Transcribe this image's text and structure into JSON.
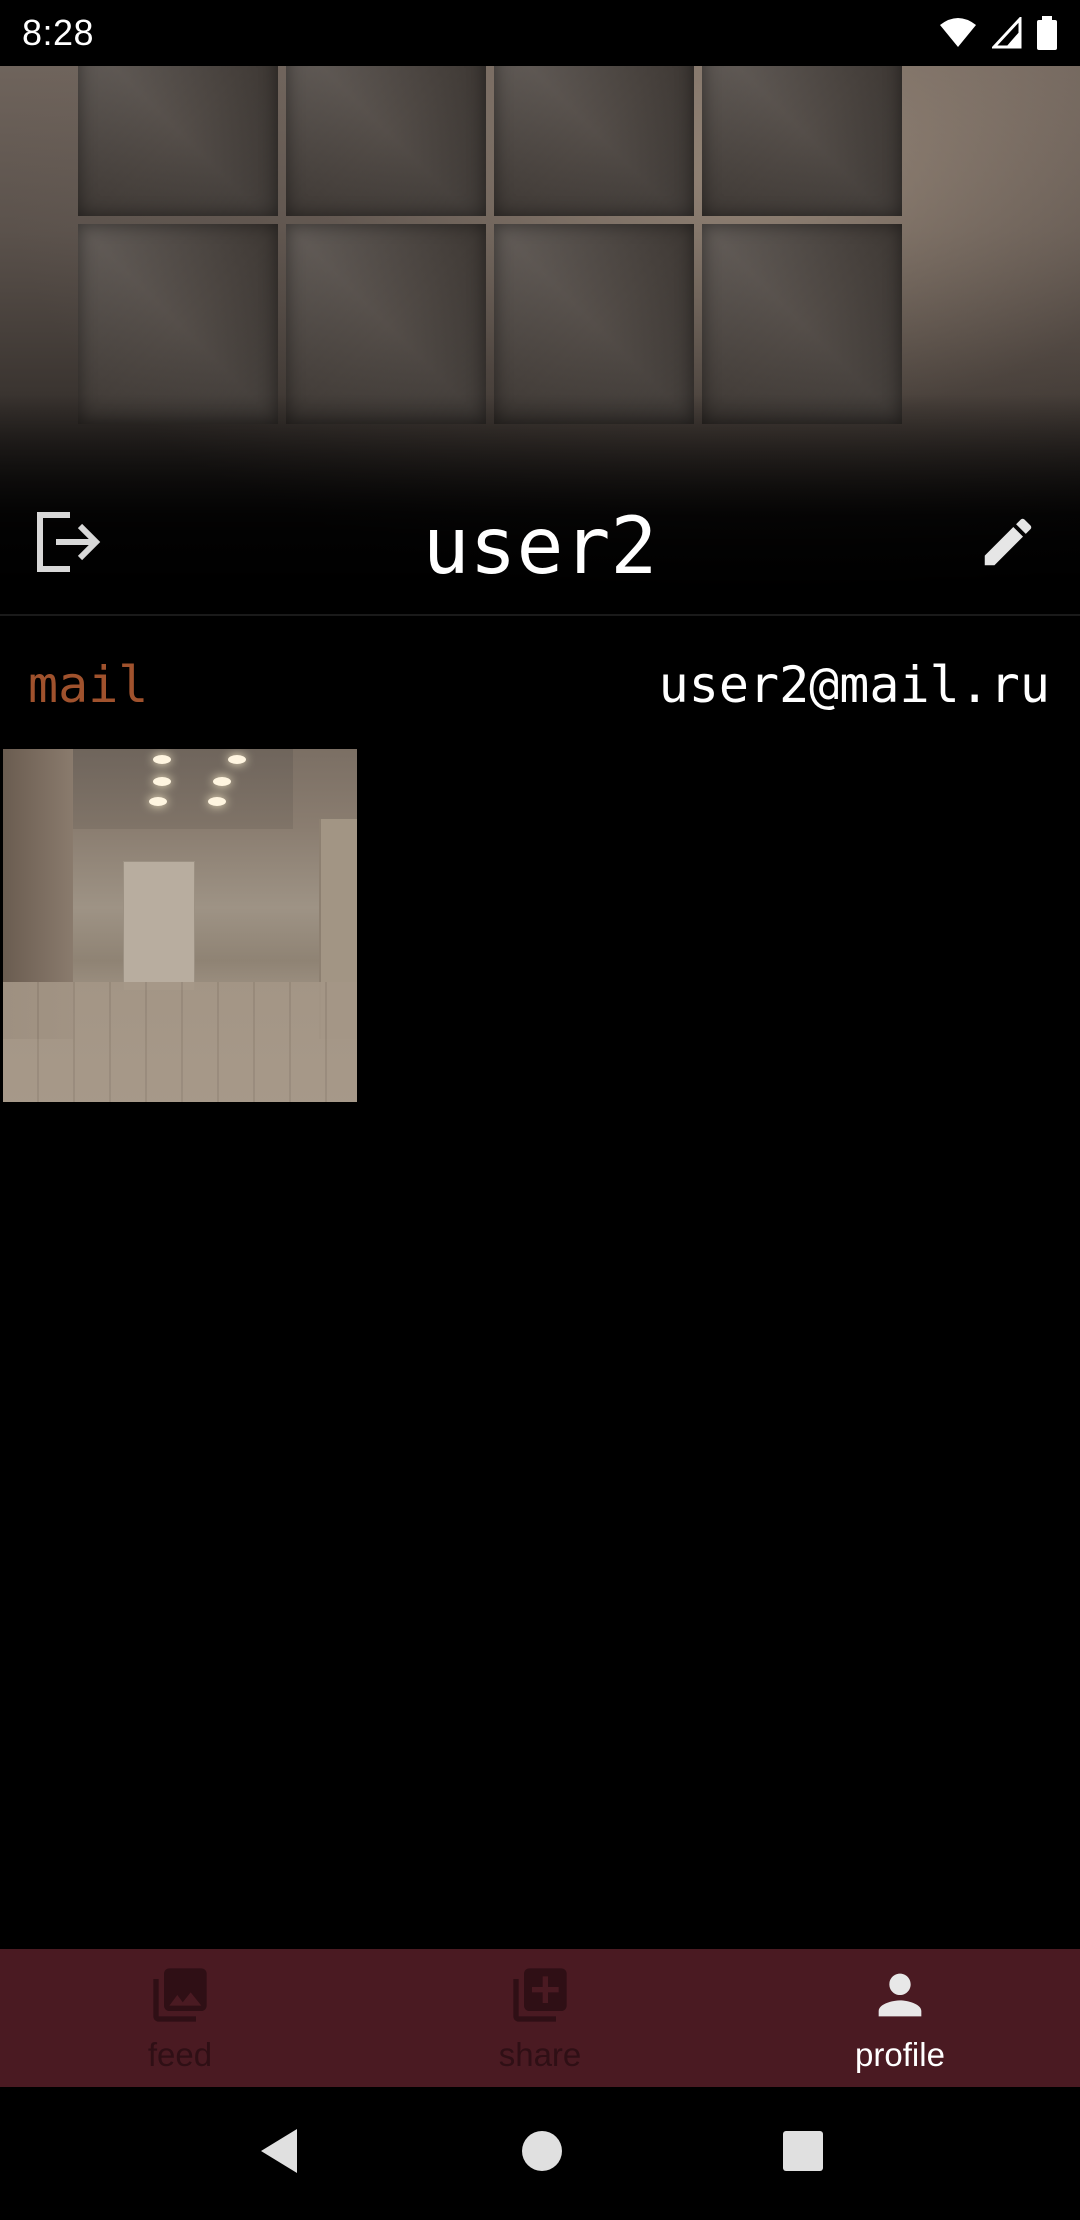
{
  "status_bar": {
    "time": "8:28",
    "icons": [
      "wifi-icon",
      "cellular-signal-icon",
      "battery-icon"
    ]
  },
  "profile": {
    "username": "user2",
    "logout_icon": "logout-icon",
    "edit_icon": "edit-pencil-icon",
    "mail_label": "mail",
    "mail_value": "user2@mail.ru"
  },
  "posts": [
    {
      "name": "post-thumbnail",
      "description_icon": "interior-photo"
    }
  ],
  "bottom_nav": {
    "items": [
      {
        "label": "feed",
        "icon": "photo-library-icon",
        "active": false
      },
      {
        "label": "share",
        "icon": "add-to-photos-icon",
        "active": false
      },
      {
        "label": "profile",
        "icon": "person-icon",
        "active": true
      }
    ]
  },
  "system_nav": {
    "icons": [
      "back-icon",
      "home-icon",
      "recents-icon"
    ]
  },
  "colors": {
    "background": "#000000",
    "mail_label": "#a0522d",
    "nav_background": "#4a1a22",
    "nav_inactive": "#2f0f15",
    "nav_active": "#ffffff"
  }
}
